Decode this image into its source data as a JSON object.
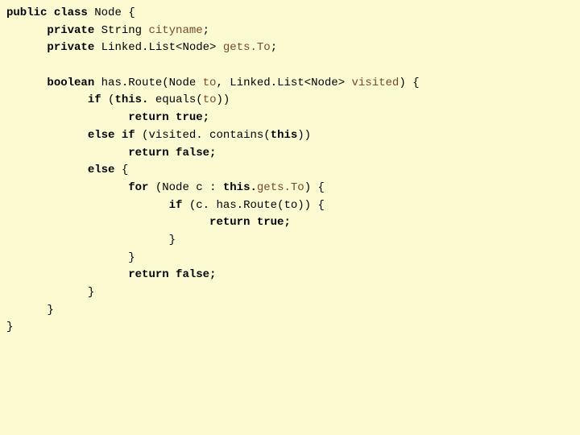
{
  "code": {
    "kw_public": "public",
    "kw_class": "class",
    "kw_private1": "private",
    "kw_private2": "private",
    "kw_boolean": "boolean",
    "kw_if": "if",
    "kw_this1": "this.",
    "kw_return_true1": "return true;",
    "kw_else_if": "else if",
    "kw_this2": "this",
    "kw_return_false1": "return false;",
    "kw_else": "else",
    "kw_for": "for",
    "kw_this3": "this.",
    "kw_if2": "if",
    "kw_return_true2": "return true;",
    "kw_return_false2": "return false;",
    "t_node_open": " Node {",
    "t_string": " String ",
    "id_cityname": "cityname",
    "t_semi": ";",
    "t_linkedlist_node": " Linked.List<Node> ",
    "id_getsTo": "gets.To",
    "t_hasRoute_open": " has.Route(Node ",
    "id_to": "to",
    "t_comma_linkedlist": ", Linked.List<Node> ",
    "id_visited": "visited",
    "t_paren_brace": ") {",
    "t_open_paren": " (",
    "t_equals_open": " equals(",
    "t_close_pp": "))",
    "t_visited_contains": " (visited. contains(",
    "t_close_pp2": "))",
    "t_brace_open": " {",
    "t_for_open": " (Node c : ",
    "t_for_close": ") {",
    "t_c_hasRoute": " (c. has.Route(to)) {",
    "brace1": "}",
    "brace2": "}",
    "brace3": "}",
    "brace4": "}",
    "brace5": "}"
  }
}
